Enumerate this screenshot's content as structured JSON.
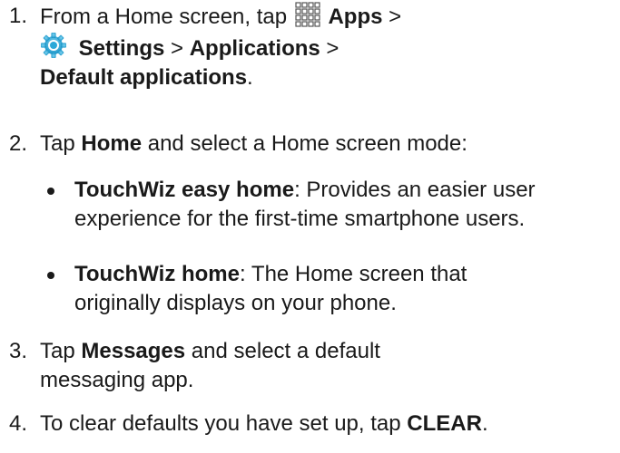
{
  "steps": [
    {
      "number": "1.",
      "parts": {
        "intro": "From a Home screen, tap",
        "apps": "Apps",
        "sep1": ">",
        "settings": "Settings",
        "sep2": ">",
        "applications": "Applications",
        "sep3": ">",
        "default_apps": "Default applications",
        "end": "."
      },
      "icons": [
        "apps-grid-icon",
        "settings-gear-icon"
      ]
    },
    {
      "number": "2.",
      "parts": {
        "tap": "Tap",
        "home": "Home",
        "rest": "and select a Home screen mode:"
      },
      "bullets": [
        {
          "term": "TouchWiz easy home",
          "desc_line1": ": Provides an easier user",
          "desc_line2": "experience for the first-time smartphone users."
        },
        {
          "term": "TouchWiz home",
          "desc_line1": ": The Home screen that",
          "desc_line2": "originally displays on your phone."
        }
      ]
    },
    {
      "number": "3.",
      "parts": {
        "tap": "Tap",
        "messages": "Messages",
        "rest_line1": "and select a default",
        "rest_line2": "messaging app."
      }
    },
    {
      "number": "4.",
      "parts": {
        "intro": "To clear defaults you have set up, tap",
        "clear": "CLEAR",
        "end": "."
      }
    }
  ],
  "colors": {
    "text": "#1a1a1a",
    "settings_icon_outer": "#2aa8d8",
    "settings_icon_inner": "#ffffff"
  }
}
